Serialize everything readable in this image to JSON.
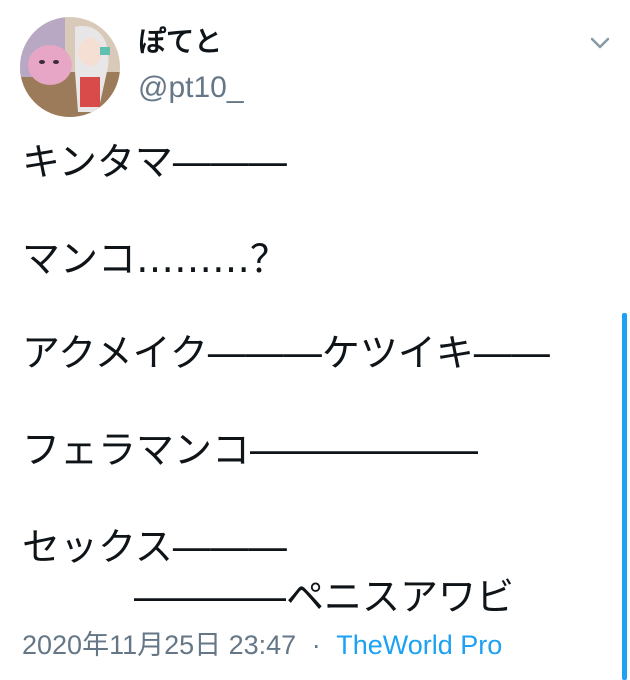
{
  "user": {
    "display_name": "ぽてと",
    "handle": "@pt10_"
  },
  "tweet": {
    "lines": [
      "キンタマ―――",
      "マンコ………？",
      "アクメイク―――ケツイキ――",
      "フェラマンコ――――――",
      "セックス―――",
      "――――ペニスアワビ"
    ]
  },
  "meta": {
    "timestamp": "2020年11月25日 23:47",
    "separator": "·",
    "source": "TheWorld Pro"
  },
  "colors": {
    "text": "#0f1419",
    "secondary": "#657786",
    "accent": "#1da1f2"
  },
  "icons": {
    "menu": "chevron-down-icon"
  }
}
